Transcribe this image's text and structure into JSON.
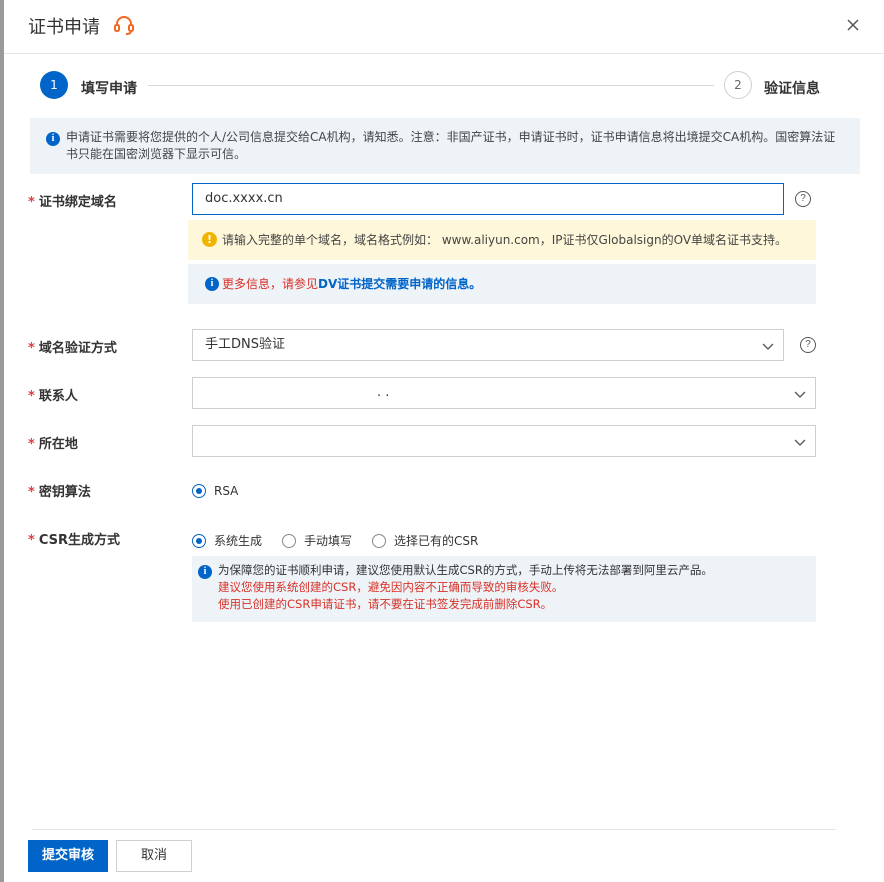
{
  "header": {
    "title": "证书申请"
  },
  "steps": [
    {
      "number": "1",
      "label": "填写申请"
    },
    {
      "number": "2",
      "label": "验证信息"
    }
  ],
  "info_banner": {
    "text": "申请证书需要将您提供的个人/公司信息提交给CA机构，请知悉。注意：非国产证书，申请证书时，证书申请信息将出境提交CA机构。国密算法证书只能在国密浏览器下显示可信。"
  },
  "form": {
    "domain": {
      "label": "证书绑定域名",
      "value": "doc.xxxx.cn",
      "warning": "请输入完整的单个域名，域名格式例如： www.aliyun.com，IP证书仅Globalsign的OV单域名证书支持。",
      "more_prefix": "更多信息，请参见",
      "more_link": "DV证书提交需要申请的信息。"
    },
    "verify_method": {
      "label": "域名验证方式",
      "value": "手工DNS验证"
    },
    "contact": {
      "label": "联系人",
      "value": ". ."
    },
    "location": {
      "label": "所在地",
      "value": ""
    },
    "key_algorithm": {
      "label": "密钥算法",
      "options": [
        "RSA"
      ]
    },
    "csr": {
      "label": "CSR生成方式",
      "options": [
        "系统生成",
        "手动填写",
        "选择已有的CSR"
      ],
      "note_line1": "为保障您的证书顺利申请，建议您使用默认生成CSR的方式，手动上传将无法部署到阿里云产品。",
      "note_line2": "建议您使用系统创建的CSR，避免因内容不正确而导致的审核失败。",
      "note_line3": "使用已创建的CSR申请证书，请不要在证书签发完成前删除CSR。"
    }
  },
  "footer": {
    "submit_label": "提交审核",
    "cancel_label": "取消"
  },
  "icons": {
    "close": "close-icon",
    "support": "headset-icon",
    "help": "question-circle-icon",
    "info": "info-icon",
    "warning": "warning-icon",
    "chevron": "chevron-down-icon"
  },
  "colors": {
    "primary": "#0064c8",
    "danger": "#d93026",
    "warning": "#f0b400",
    "support": "#f26a21"
  }
}
